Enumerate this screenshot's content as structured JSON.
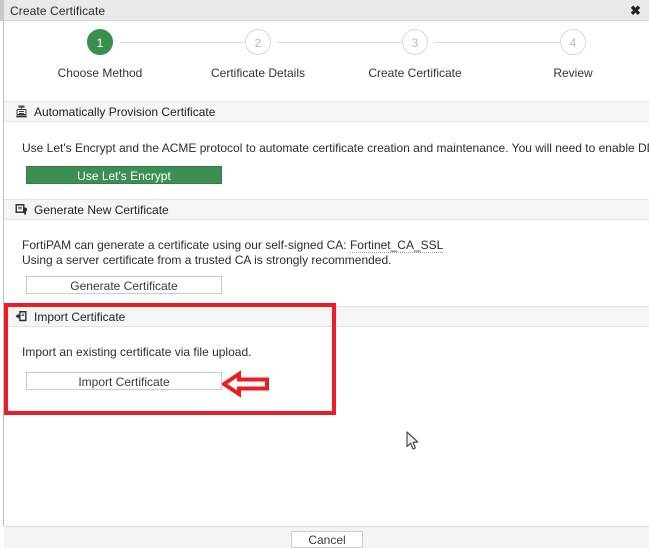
{
  "window": {
    "title": "Create Certificate",
    "close_label": "✖"
  },
  "stepper": {
    "steps": [
      {
        "number": "1",
        "label": "Choose Method",
        "state": "active"
      },
      {
        "number": "2",
        "label": "Certificate Details",
        "state": "inactive"
      },
      {
        "number": "3",
        "label": "Create Certificate",
        "state": "inactive"
      },
      {
        "number": "4",
        "label": "Review",
        "state": "inactive"
      }
    ],
    "active_color": "#3a8f4f",
    "inactive_color": "#b9b9b9",
    "connector_color": "#dcdcdc"
  },
  "sections": {
    "auto_provision": {
      "title": "Automatically Provision Certificate",
      "icon": "certificate-stamp-icon",
      "description": "Use Let's Encrypt and the ACME protocol to automate certificate creation and maintenance. You will need to enable DDNS or purchase a domain.",
      "button_label": "Use Let's Encrypt",
      "button_color": "#3c8f52"
    },
    "generate_new": {
      "title": "Generate New Certificate",
      "icon": "generate-certificate-icon",
      "description_line1_prefix": "FortiPAM can generate a certificate using our self-signed CA: ",
      "description_line1_ca": "Fortinet_CA_SSL",
      "description_line2": "Using a server certificate from a trusted CA is strongly recommended.",
      "button_label": "Generate Certificate"
    },
    "import": {
      "title": "Import Certificate",
      "icon": "import-certificate-icon",
      "description": "Import an existing certificate via file upload.",
      "button_label": "Import Certificate",
      "highlight_color": "#ee1c23",
      "annotation": "left-pointing-arrow"
    }
  },
  "footer": {
    "cancel_label": "Cancel"
  }
}
